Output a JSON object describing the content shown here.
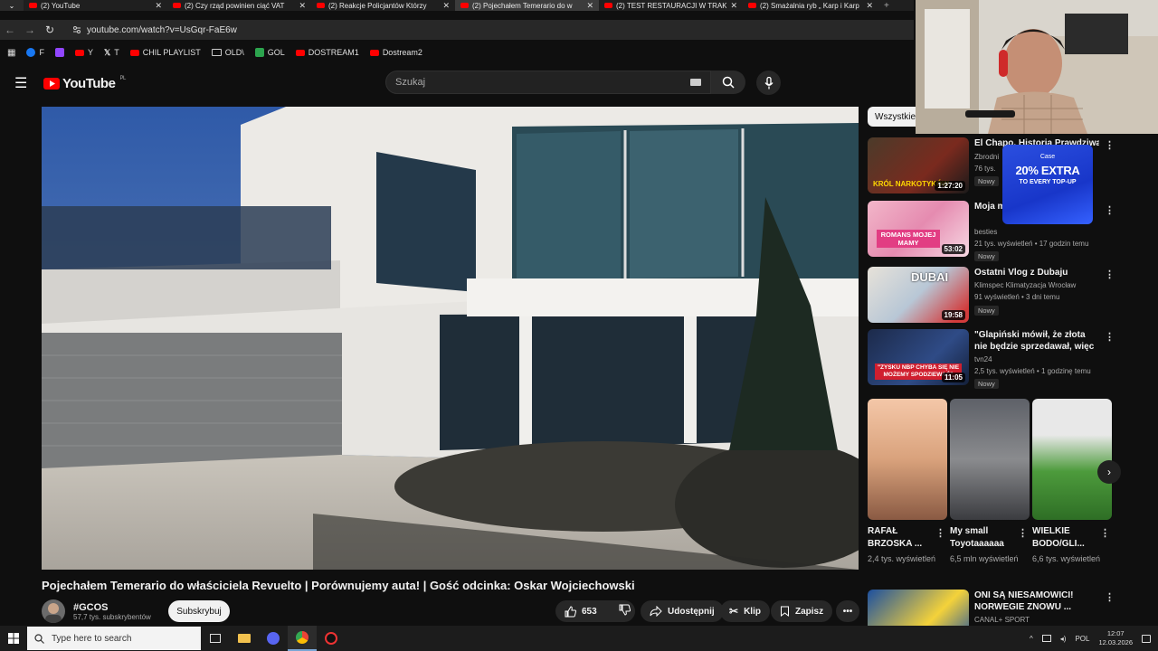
{
  "browser": {
    "tabs": [
      {
        "title": "(2) YouTube",
        "active": false
      },
      {
        "title": "(2) Czy rząd powinien ciąć VAT",
        "active": false
      },
      {
        "title": "(2) Reakcje Policjantów Którzy",
        "active": false
      },
      {
        "title": "(2) Pojechałem Temerario do w",
        "active": true
      },
      {
        "title": "(2) TEST RESTAURACJI W TRAK",
        "active": false
      },
      {
        "title": "(2) Smażalnia ryb „ Karp i Karp",
        "active": false
      }
    ],
    "url": "youtube.com/watch?v=UsGqr-FaE6w",
    "bookmarks": [
      {
        "label": "F",
        "color": "#1877f2"
      },
      {
        "label": "",
        "color": "#9146ff"
      },
      {
        "label": "Y",
        "color": "#ff0000"
      },
      {
        "label": "T",
        "color": "#ffffff"
      },
      {
        "label": "CHIL PLAYLIST",
        "color": "#ff0000"
      },
      {
        "label": "OLD\\",
        "color": "#cccccc"
      },
      {
        "label": "GOL",
        "color": "#2ca44e"
      },
      {
        "label": "DOSTREAM1",
        "color": "#ff0000"
      },
      {
        "label": "Dostream2",
        "color": "#ff0000"
      }
    ]
  },
  "youtube": {
    "logo_text": "YouTube",
    "region": "PL",
    "search_placeholder": "Szukaj"
  },
  "video": {
    "title": "Pojechałem Temerario do właściciela Revuelto | Porównujemy auta! | Gość odcinka: Oskar Wojciechowski",
    "channel": "#GCOS",
    "subscribers": "57,7 tys. subskrybentów",
    "subscribe_label": "Subskrybuj",
    "likes": "653",
    "share_label": "Udostępnij",
    "clip_label": "Klip",
    "save_label": "Zapisz"
  },
  "sidebar": {
    "chip": "Wszystkie",
    "recommendations": [
      {
        "title": "El Chapo. Historia Prawdziwa",
        "channel": "Zbrodni",
        "meta": "76 tys.",
        "badge": "Nowy",
        "duration": "1:27:20",
        "thumb_text": "KRÓL NARKOTYKÓW"
      },
      {
        "title": "Moja m mojego",
        "channel": "besties",
        "meta": "21 tys. wyświetleń • 17 godzin temu",
        "badge": "Nowy",
        "duration": "53:02",
        "thumb_text": "ROMANS MOJEJ MAMY"
      },
      {
        "title": "Ostatni Vlog z Dubaju",
        "channel": "Klimspec Klimatyzacja Wrocław",
        "meta": "91 wyświetleń • 3 dni temu",
        "badge": "Nowy",
        "duration": "19:58",
        "thumb_text": "DUBAI"
      },
      {
        "title": "\"Glapiński mówił, że złota nie będzie sprzedawał, więc zysku...",
        "channel": "tvn24",
        "meta": "2,5 tys. wyświetleń • 1 godzinę temu",
        "badge": "Nowy",
        "duration": "11:05",
        "thumb_text": "\"ZYSKU NBP CHYBA SIĘ NIE MOŻEMY SPODZIEWAĆ\""
      }
    ],
    "shorts": [
      {
        "title": "RAFAŁ BRZOSKA ...",
        "views": "2,4 tys. wyświetleń"
      },
      {
        "title": "My small Toyotaaaaaa",
        "views": "6,5 mln wyświetleń"
      },
      {
        "title": "WIELKIE BODO/GLI...",
        "views": "6,6 tys. wyświetleń"
      }
    ],
    "last_rec": {
      "title": "ONI SĄ NIESAMOWICI! NORWEGIE ZNOWU ...",
      "channel": "CANAL+ SPORT"
    }
  },
  "ad": {
    "brand": "Case",
    "headline": "20% EXTRA",
    "sub": "TO EVERY TOP-UP"
  },
  "taskbar": {
    "search_placeholder": "Type here to search",
    "lang": "POL",
    "time": "12:07",
    "date": "12.03.2026"
  }
}
